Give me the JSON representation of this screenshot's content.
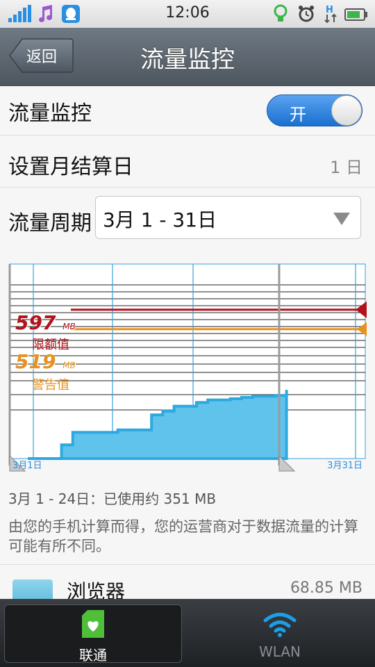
{
  "status_bar": {
    "time": "12:06",
    "left_icons": [
      "signal-icon",
      "music-icon",
      "qq-icon"
    ],
    "right_icons": [
      "bulb-icon",
      "alarm-icon",
      "hspa-data-icon",
      "battery-icon"
    ]
  },
  "nav": {
    "back_label": "返回",
    "title": "流量监控"
  },
  "monitor": {
    "label": "流量监控",
    "toggle_label": "开",
    "toggle_on": true
  },
  "billing_day": {
    "label": "设置月结算日",
    "value": "1 日"
  },
  "cycle": {
    "label": "流量周期",
    "selected": "3月 1 - 31日"
  },
  "chart_data": {
    "type": "area",
    "x_labels": {
      "start": "3月1日",
      "end": "3月31日"
    },
    "x": [
      1,
      2,
      3,
      4,
      5,
      6,
      7,
      8,
      9,
      10,
      11,
      12,
      13,
      14,
      15,
      16,
      17,
      18,
      19,
      20,
      21,
      22,
      23,
      24
    ],
    "values": [
      0,
      0,
      0,
      55,
      105,
      105,
      105,
      105,
      115,
      115,
      115,
      175,
      190,
      210,
      210,
      225,
      235,
      235,
      240,
      245,
      250,
      250,
      253,
      275
    ],
    "xlim": [
      1,
      31
    ],
    "ylim": [
      0,
      780
    ],
    "limit": {
      "value": "597",
      "unit": "MB",
      "label": "限额值",
      "color": "#b3121a"
    },
    "warning": {
      "value": "519",
      "unit": "MB",
      "label": "警告值",
      "color": "#e8911e"
    },
    "fill_color": "#5fc3ec",
    "grid": true
  },
  "usage_summary": "3月 1 - 24日：已使用约 351 MB",
  "note": "由您的手机计算而得，您的运营商对于数据流量的计算可能有所不同。",
  "apps": [
    {
      "name": "浏览器",
      "size": "68.85 MB"
    }
  ],
  "tabs": [
    {
      "label": "联通",
      "icon": "unicom-sim-icon",
      "active": true
    },
    {
      "label": "WLAN",
      "icon": "wifi-icon",
      "active": false
    }
  ]
}
